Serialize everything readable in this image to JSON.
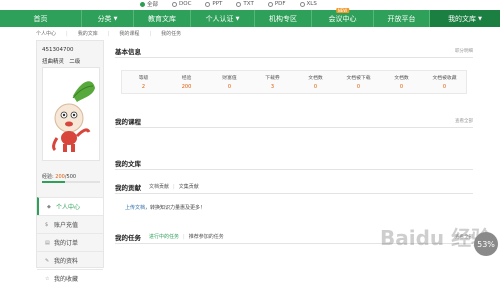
{
  "search_types": [
    {
      "label": "全部",
      "selected": true
    },
    {
      "label": "DOC",
      "selected": false
    },
    {
      "label": "PPT",
      "selected": false
    },
    {
      "label": "TXT",
      "selected": false
    },
    {
      "label": "PDF",
      "selected": false
    },
    {
      "label": "XLS",
      "selected": false
    }
  ],
  "nav": {
    "home": "首页",
    "category": "分类",
    "edu": "教育文库",
    "personal": "个人认证",
    "org": "机构专区",
    "vip": "会议中心",
    "vip_badge": "NEW",
    "open": "开放平台",
    "my": "我的文库"
  },
  "subnav": [
    "个人中心",
    "我的文库",
    "我的课程",
    "我的任务"
  ],
  "user": {
    "id": "451304700",
    "level": "扭曲精灵",
    "rank": "二级",
    "xp_label": "经验:",
    "xp_value": "200",
    "xp_max": "/500",
    "xp_fraction": 0.4
  },
  "menu": [
    {
      "label": "个人中心",
      "icon": "◆",
      "active": true
    },
    {
      "label": "账户充值",
      "icon": "$"
    },
    {
      "label": "我的订单",
      "icon": "▤"
    },
    {
      "label": "我的资料",
      "icon": "✎"
    },
    {
      "label": "我的收藏",
      "icon": "☆"
    }
  ],
  "basic": {
    "title": "基本信息",
    "right": "职分明细",
    "stats": [
      {
        "k": "等级",
        "v": "2"
      },
      {
        "k": "经验",
        "v": "200"
      },
      {
        "k": "财富值",
        "v": "0"
      },
      {
        "k": "下载券",
        "v": "3"
      },
      {
        "k": "文档数",
        "v": "0"
      },
      {
        "k": "文档被下载",
        "v": "0"
      },
      {
        "k": "文档数",
        "v": "0"
      },
      {
        "k": "文档被收藏",
        "v": "0"
      }
    ]
  },
  "courses": {
    "title": "我的课程",
    "right": "查看全部"
  },
  "docs": {
    "title": "我的文库"
  },
  "contrib": {
    "title": "我的贡献",
    "tab1": "文档贡献",
    "tab2": "文集贡献",
    "upload_link": "上传文档",
    "upload_text": "，转换知识力量惠及更多！"
  },
  "tasks": {
    "title": "我的任务",
    "tab1": "进行中的任务",
    "tab2": "推荐参加的任务",
    "right": "查看全部"
  },
  "watermark": "Baidu 经验",
  "progress": "53%"
}
